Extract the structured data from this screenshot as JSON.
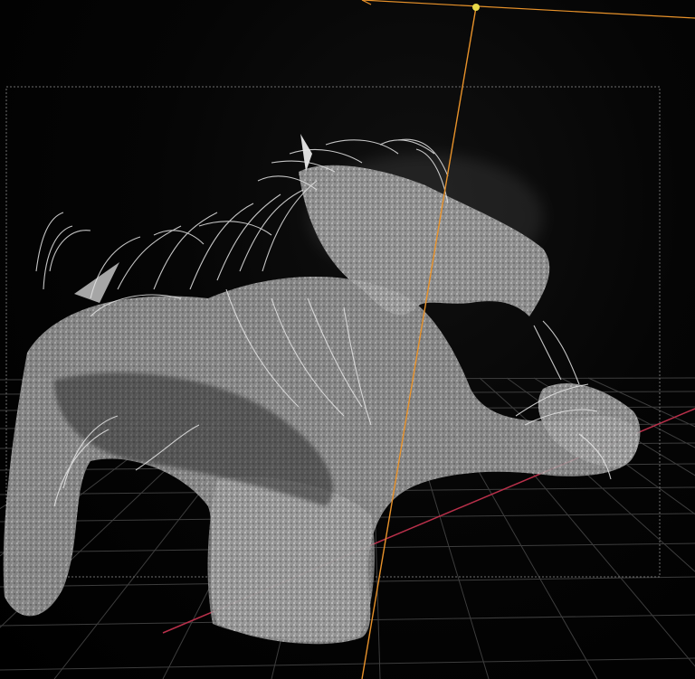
{
  "viewport": {
    "background": "#000000",
    "object": "creature-hair-pointcloud",
    "grid": true
  },
  "colors": {
    "grid_line": "#4a4a4a",
    "x_axis": "#b8304a",
    "camera_line": "#e8922a",
    "camera_handle": "#e8d94a",
    "frame_border": "#777777",
    "pointcloud": "#d8d8d8"
  },
  "icons": {
    "camera_handle": "camera-handle-icon"
  }
}
